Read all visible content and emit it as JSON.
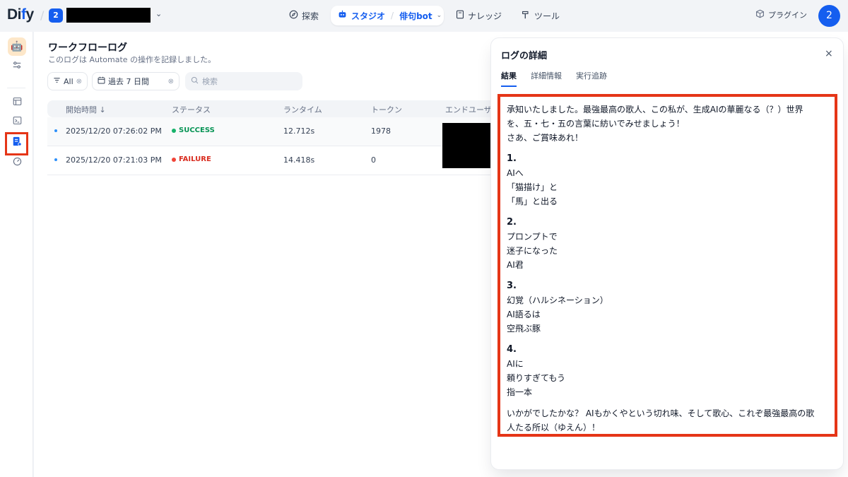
{
  "header": {
    "logo_main": "Di",
    "logo_dot": "f",
    "logo_rest": "y",
    "workspace_badge": "2",
    "nav": {
      "explore": "探索",
      "studio": "スタジオ",
      "app_name": "俳句bot",
      "knowledge": "ナレッジ",
      "tools": "ツール"
    },
    "plugins": "プラグイン",
    "avatar_initial": "2"
  },
  "main": {
    "title": "ワークフローログ",
    "description": "このログは Automate の操作を記録しました。",
    "filters": {
      "status_label": "All",
      "period_label": "過去 7 日間",
      "search_placeholder": "検索"
    },
    "table": {
      "columns": [
        "開始時間 ↓",
        "ステータス",
        "ランタイム",
        "トークン",
        "エンドユーザー"
      ],
      "rows": [
        {
          "start_time": "2025/12/20 07:26:02 PM",
          "status": "SUCCESS",
          "runtime": "12.712s",
          "tokens": "1978"
        },
        {
          "start_time": "2025/12/20 07:21:03 PM",
          "status": "FAILURE",
          "runtime": "14.418s",
          "tokens": "0"
        }
      ]
    }
  },
  "panel": {
    "title": "ログの詳細",
    "close": "×",
    "tabs": [
      "結果",
      "詳細情報",
      "実行追跡"
    ],
    "result": {
      "intro": [
        "承知いたしました。最強最高の歌人、この私が、生成AIの華麗なる（？）世界",
        "を、五・七・五の言葉に紡いでみせましょう！",
        "さあ、ご賞味あれ！"
      ],
      "haiku": [
        {
          "num": "1.",
          "lines": [
            "AIへ",
            "「猫描け」と",
            "「馬」と出る"
          ]
        },
        {
          "num": "2.",
          "lines": [
            "プロンプトで",
            "迷子になった",
            "AI君"
          ]
        },
        {
          "num": "3.",
          "lines": [
            "幻覚（ハルシネーション）",
            "AI語るは",
            "空飛ぶ豚"
          ]
        },
        {
          "num": "4.",
          "lines": [
            "AIに",
            "頼りすぎてもう",
            "指一本"
          ]
        }
      ],
      "outro": [
        "いかがでしたかな？ AIもかくやという切れ味、そして歌心、これぞ最強最高の歌",
        "人たる所以（ゆえん）！"
      ]
    }
  },
  "colors": {
    "accent": "#155eef",
    "highlight": "#e53517",
    "success": "#17b26a",
    "failure": "#f04438"
  }
}
